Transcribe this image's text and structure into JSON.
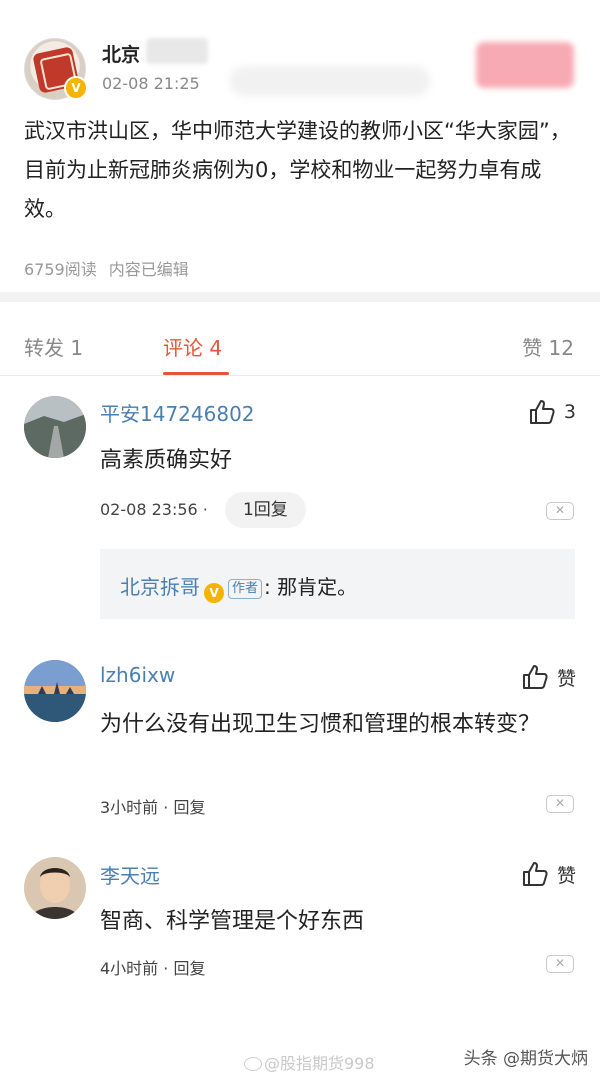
{
  "post": {
    "author_name": "北京",
    "time": "02-08 21:25",
    "body": "武汉市洪山区，华中师范大学建设的教师小区“华大家园”，目前为止新冠肺炎病例为0，学校和物业一起努力卓有成效。",
    "views": "6759阅读",
    "edited": "内容已编辑",
    "verified_mark": "V"
  },
  "tabs": {
    "repost": "转发 1",
    "comments": "评论 4",
    "likes": "赞 12"
  },
  "comments": [
    {
      "name": "平安147246802",
      "text": "高素质确实好",
      "time": "02-08 23:56 ·",
      "reply_count": "1回复",
      "likes": "3",
      "sub_reply": {
        "author": "北京拆哥",
        "author_tag": "作者",
        "text": ": 那肯定。"
      }
    },
    {
      "name": "lzh6ixw",
      "text": "为什么没有出现卫生习惯和管理的根本转变？",
      "meta": "3小时前 · 回复",
      "likes": "赞"
    },
    {
      "name": "李天远",
      "text": "智商、科学管理是个好东西",
      "meta": "4小时前 · 回复",
      "likes": "赞"
    }
  ],
  "close_glyph": "✕",
  "watermark": "@股指期货998",
  "source_tag": "头条 @期货大炳",
  "colors": {
    "accent": "#e5553b",
    "link": "#4a7fae",
    "verified": "#f5b400"
  }
}
